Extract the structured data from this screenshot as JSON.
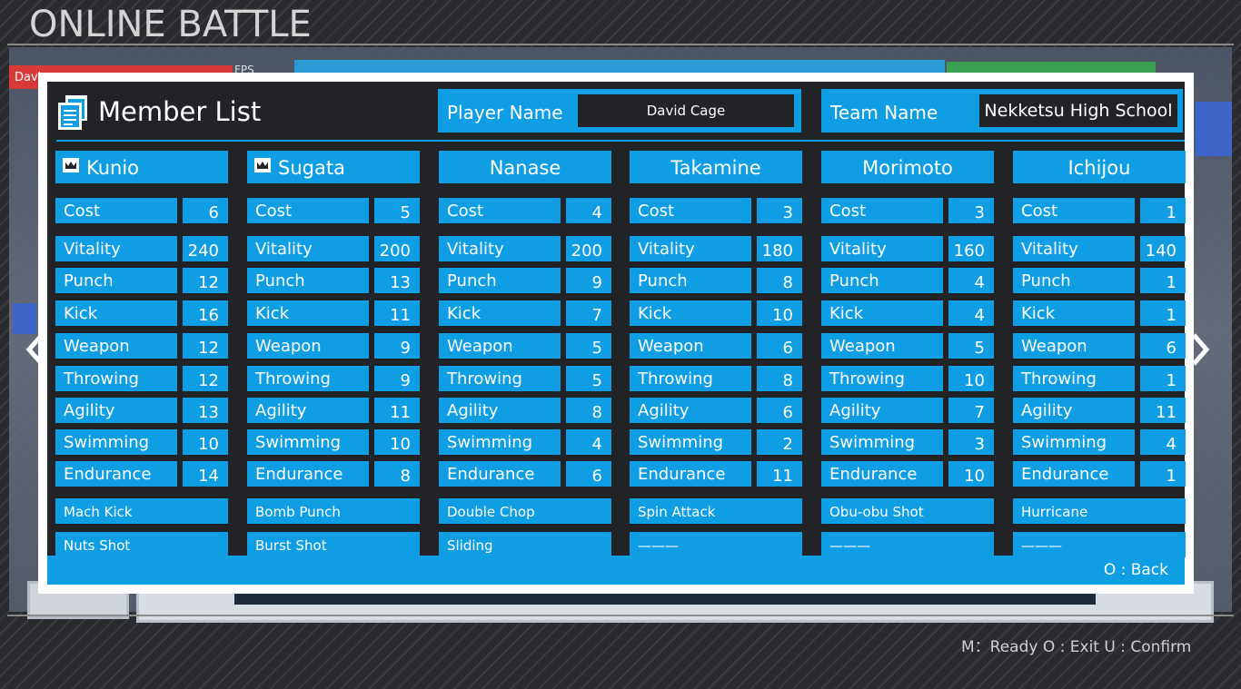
{
  "screen": {
    "title": "ONLINE BATTLE",
    "bg_tab_name": "Davi",
    "bg_fps": "FPS",
    "controls_hint": "M：Ready  O : Exit  U : Confirm"
  },
  "panel": {
    "title": "Member List",
    "icon": "document-stack-icon",
    "player_label": "Player Name",
    "player_name": "David Cage",
    "team_label": "Team Name",
    "team_name": "Nekketsu High School",
    "back_label": "O : Back"
  },
  "stat_labels": [
    "Cost",
    "Vitality",
    "Punch",
    "Kick",
    "Weapon",
    "Throwing",
    "Agility",
    "Swimming",
    "Endurance"
  ],
  "members": [
    {
      "name": "Kunio",
      "leader": true,
      "stats": [
        6,
        240,
        12,
        16,
        12,
        12,
        13,
        10,
        14
      ],
      "skills": [
        "Mach Kick",
        "Nuts Shot"
      ]
    },
    {
      "name": "Sugata",
      "leader": true,
      "stats": [
        5,
        200,
        13,
        11,
        9,
        9,
        11,
        10,
        8
      ],
      "skills": [
        "Bomb Punch",
        "Burst Shot"
      ]
    },
    {
      "name": "Nanase",
      "leader": false,
      "stats": [
        4,
        200,
        9,
        7,
        5,
        5,
        8,
        4,
        6
      ],
      "skills": [
        "Double Chop",
        "Sliding"
      ]
    },
    {
      "name": "Takamine",
      "leader": false,
      "stats": [
        3,
        180,
        8,
        10,
        6,
        8,
        6,
        2,
        11
      ],
      "skills": [
        "Spin Attack",
        "———"
      ]
    },
    {
      "name": "Morimoto",
      "leader": false,
      "stats": [
        3,
        160,
        4,
        4,
        5,
        10,
        7,
        3,
        10
      ],
      "skills": [
        "Obu-obu Shot",
        "———"
      ]
    },
    {
      "name": "Ichijou",
      "leader": false,
      "stats": [
        1,
        140,
        1,
        1,
        6,
        1,
        11,
        4,
        1
      ],
      "skills": [
        "Hurricane",
        "———"
      ]
    }
  ],
  "colors": {
    "accent": "#0f9ee4",
    "panel_bg": "#212327",
    "frame": "#ffffff"
  }
}
